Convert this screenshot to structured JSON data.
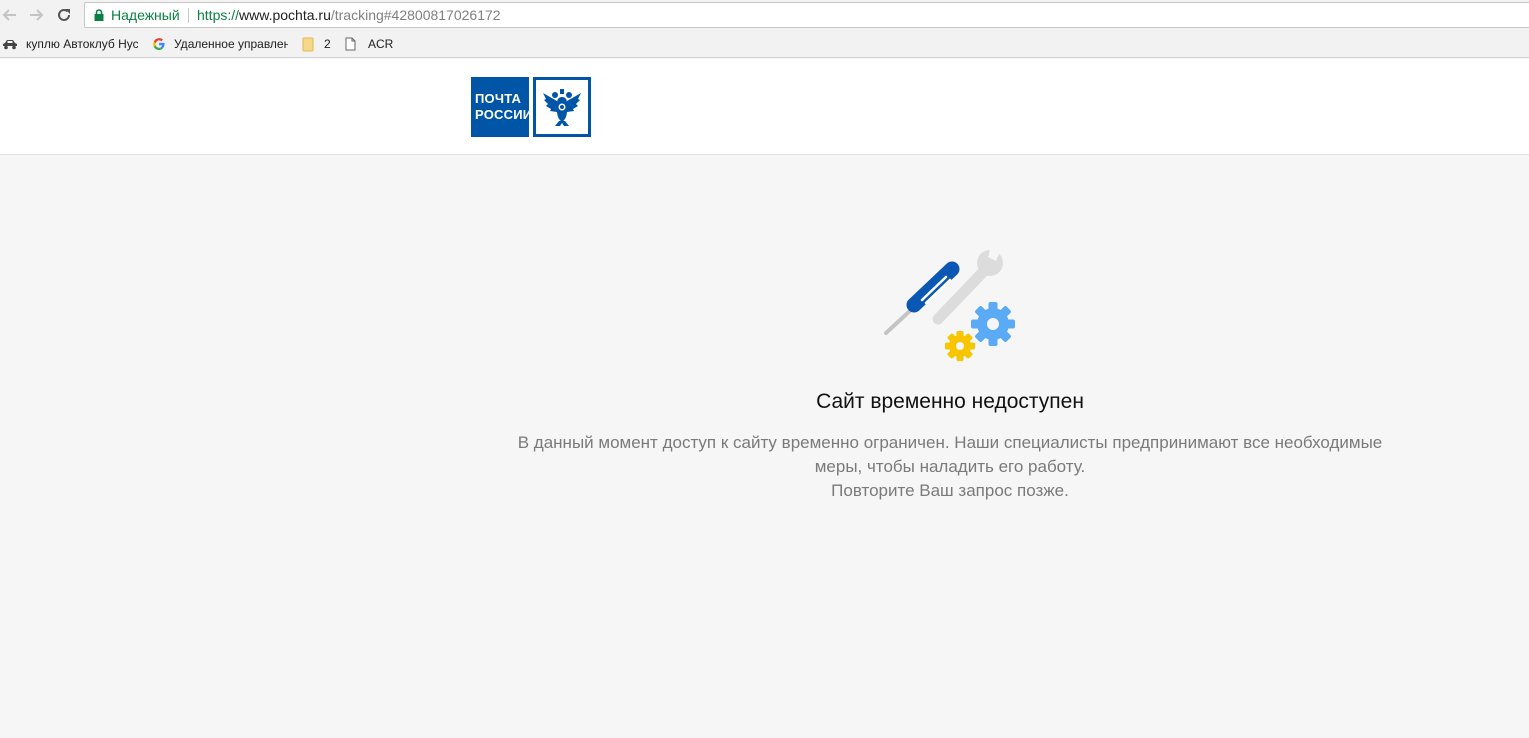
{
  "browser": {
    "secure_label": "Надежный",
    "url_scheme": "https://",
    "url_host": "www.pochta.ru",
    "url_path": "/tracking#42800817026172",
    "bookmarks": [
      {
        "label": "куплю Автоклуб Нус",
        "icon": "car-icon"
      },
      {
        "label": "Удаленное управлен",
        "icon": "google-icon"
      },
      {
        "label": "2",
        "icon": "folder-icon"
      },
      {
        "label": "ACR",
        "icon": "page-icon"
      }
    ]
  },
  "logo": {
    "line1": "ПОЧТА",
    "line2": "РОССИИ",
    "emblem_icon": "double-eagle-icon"
  },
  "maintenance": {
    "illustration_icon": "tools-and-gears-icon",
    "title": "Сайт временно недоступен",
    "message_line1": "В данный момент доступ к сайту временно ограничен. Наши специалисты предпринимают все необходимые",
    "message_line2": "меры, чтобы наладить его работу.",
    "message_line3": "Повторите Ваш запрос позже."
  },
  "colors": {
    "brand_blue": "#0055a6",
    "secure_green": "#0b8043",
    "gear_blue": "#5aaaf5",
    "gear_yellow": "#f7c600",
    "page_background": "#f6f6f6"
  }
}
